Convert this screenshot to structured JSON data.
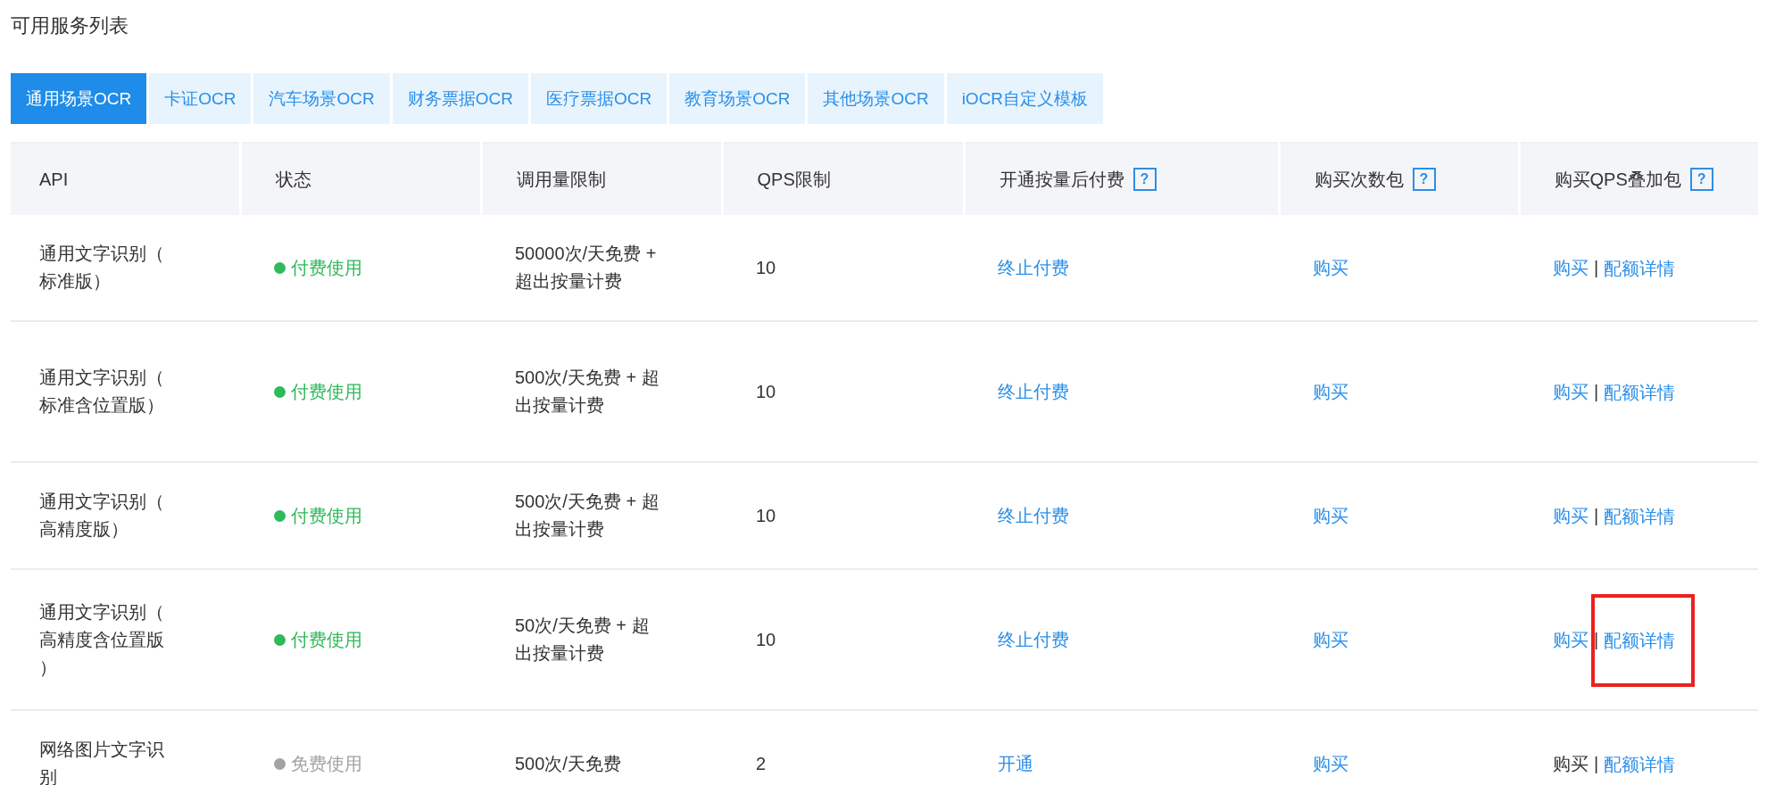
{
  "title": "可用服务列表",
  "tabs": [
    {
      "label": "通用场景OCR",
      "selected": true
    },
    {
      "label": "卡证OCR",
      "selected": false
    },
    {
      "label": "汽车场景OCR",
      "selected": false
    },
    {
      "label": "财务票据OCR",
      "selected": false
    },
    {
      "label": "医疗票据OCR",
      "selected": false
    },
    {
      "label": "教育场景OCR",
      "selected": false
    },
    {
      "label": "其他场景OCR",
      "selected": false
    },
    {
      "label": "iOCR自定义模板",
      "selected": false
    }
  ],
  "table": {
    "columns": [
      {
        "label": "API"
      },
      {
        "label": "状态"
      },
      {
        "label": "调用量限制"
      },
      {
        "label": "QPS限制"
      },
      {
        "label": "开通按量后付费",
        "help": "?"
      },
      {
        "label": "购买次数包",
        "help": "?"
      },
      {
        "label": "购买QPS叠加包",
        "help": "?"
      }
    ],
    "rows": [
      {
        "api": "通用文字识别（标准版）",
        "status": {
          "label": "付费使用",
          "kind": "paid"
        },
        "limit": "50000次/天免费 + 超出按量计费",
        "qps": "10",
        "postpaid": "终止付费",
        "pack": "购买",
        "qps_buy": {
          "label": "购买",
          "disabled": false
        },
        "separator": "|",
        "detail": {
          "label": "配额详情",
          "highlighted": false
        }
      },
      {
        "api": "通用文字识别（标准含位置版）",
        "status": {
          "label": "付费使用",
          "kind": "paid"
        },
        "limit": "500次/天免费 + 超出按量计费",
        "qps": "10",
        "postpaid": "终止付费",
        "pack": "购买",
        "qps_buy": {
          "label": "购买",
          "disabled": false
        },
        "separator": "|",
        "detail": {
          "label": "配额详情",
          "highlighted": false
        }
      },
      {
        "api": "通用文字识别（高精度版）",
        "status": {
          "label": "付费使用",
          "kind": "paid"
        },
        "limit": "500次/天免费 + 超出按量计费",
        "qps": "10",
        "postpaid": "终止付费",
        "pack": "购买",
        "qps_buy": {
          "label": "购买",
          "disabled": false
        },
        "separator": "|",
        "detail": {
          "label": "配额详情",
          "highlighted": false
        }
      },
      {
        "api": "通用文字识别（高精度含位置版）",
        "status": {
          "label": "付费使用",
          "kind": "paid"
        },
        "limit": "50次/天免费 + 超出按量计费",
        "qps": "10",
        "postpaid": "终止付费",
        "pack": "购买",
        "qps_buy": {
          "label": "购买",
          "disabled": false
        },
        "separator": "|",
        "detail": {
          "label": "配额详情",
          "highlighted": true
        }
      },
      {
        "api": "网络图片文字识别",
        "status": {
          "label": "免费使用",
          "kind": "free"
        },
        "limit": "500次/天免费",
        "qps": "2",
        "postpaid": "开通",
        "pack": "购买",
        "qps_buy": {
          "label": "购买",
          "disabled": true
        },
        "separator": "|",
        "detail": {
          "label": "配额详情",
          "highlighted": false
        }
      }
    ]
  }
}
